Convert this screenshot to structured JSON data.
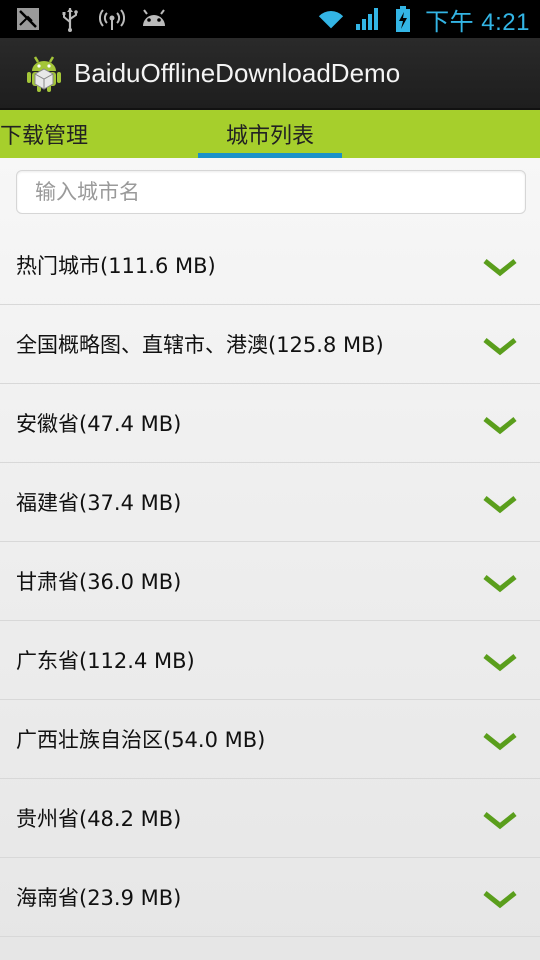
{
  "status_bar": {
    "left_icons": [
      "signal-off-icon",
      "usb-icon",
      "wifi-hotspot-icon",
      "android-debug-icon"
    ],
    "right_icons": [
      "wifi-icon",
      "cell-signal-icon",
      "battery-charging-icon"
    ],
    "time": "下午 4:21"
  },
  "action_bar": {
    "title": "BaiduOfflineDownloadDemo",
    "icon": "android-app-icon"
  },
  "tabs": [
    {
      "label": "下载管理",
      "active": false
    },
    {
      "label": "城市列表",
      "active": true
    }
  ],
  "search": {
    "placeholder": "输入城市名",
    "value": ""
  },
  "cities": [
    {
      "label": "热门城市(111.6 MB)"
    },
    {
      "label": "全国概略图、直辖市、港澳(125.8 MB)"
    },
    {
      "label": "安徽省(47.4 MB)"
    },
    {
      "label": "福建省(37.4 MB)"
    },
    {
      "label": "甘肃省(36.0 MB)"
    },
    {
      "label": "广东省(112.4 MB)"
    },
    {
      "label": "广西壮族自治区(54.0 MB)"
    },
    {
      "label": "贵州省(48.2 MB)"
    },
    {
      "label": "海南省(23.9 MB)"
    }
  ],
  "colors": {
    "tab_bar": "#a6cf2c",
    "tab_indicator": "#1a91c9",
    "check": "#5a9e1c",
    "status_icons": "#33b5e5"
  }
}
